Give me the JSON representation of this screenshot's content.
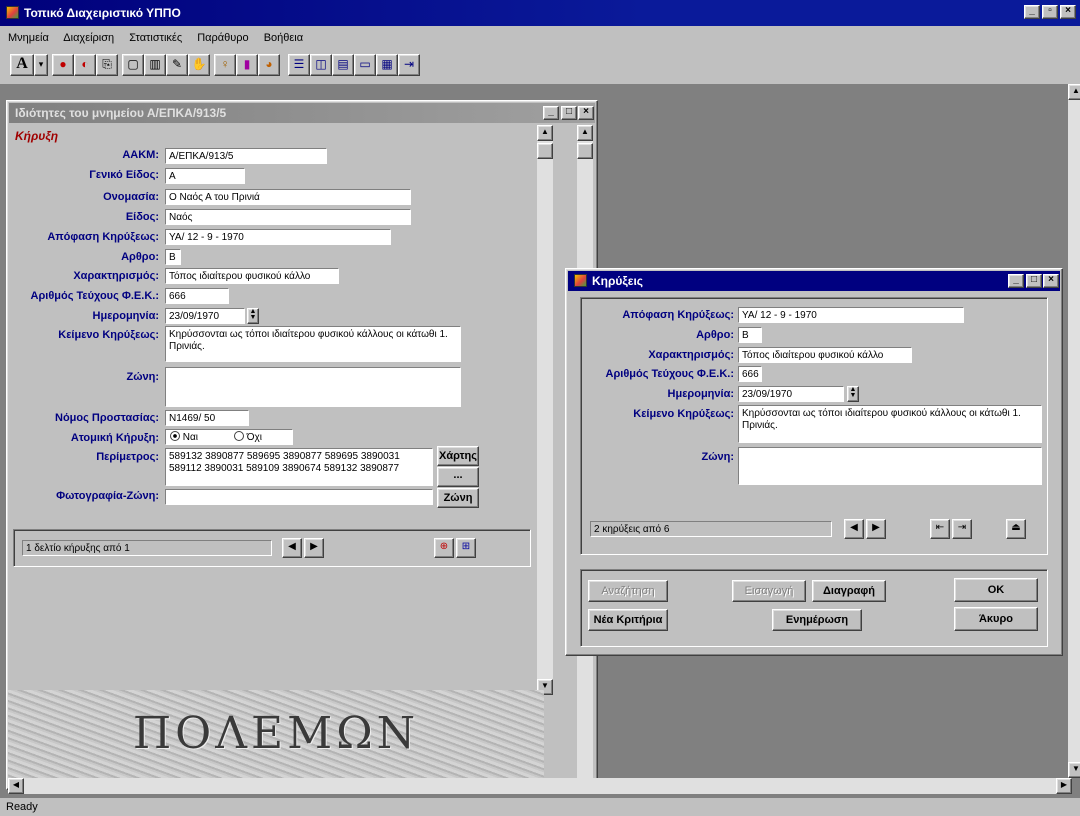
{
  "app": {
    "title": "Τοπικό Διαχειριστικό ΥΠΠΟ"
  },
  "menu": [
    "Μνημεία",
    "Διαχείριση",
    "Στατιστικές",
    "Παράθυρο",
    "Βοήθεια"
  ],
  "toolbar": {
    "font_button": "A",
    "dropdown_arrow": "▾"
  },
  "props_window": {
    "title": "Ιδιότητες του μνημείου Α/ΕΠΚΑ/913/5",
    "section": "Κήρυξη",
    "labels": {
      "aakm": "ΑΑΚΜ:",
      "geniko_eidos": "Γενικό Είδος:",
      "onomasia": "Ονομασία:",
      "eidos": "Είδος:",
      "apofasi": "Απόφαση Κηρύξεως:",
      "arthro": "Αρθρο:",
      "xaraktirismos": "Χαρακτηρισμός:",
      "arithmos_fek": "Αριθμός Τεύχους Φ.Ε.Κ.:",
      "imerominia": "Ημερομηνία:",
      "keimeno": "Κείμενο Κηρύξεως:",
      "zoni": "Ζώνη:",
      "nomos": "Νόμος Προστασίας:",
      "atomiki": "Ατομική Κήρυξη:",
      "perimetros": "Περίμετρος:",
      "fotografia": "Φωτογραφία-Ζώνη:"
    },
    "values": {
      "aakm": "Α/ΕΠΚΑ/913/5",
      "geniko_eidos": "Α",
      "onomasia": "Ο Ναός Α του Πρινιά",
      "eidos": "Ναός",
      "apofasi": "ΥΑ/ 12 - 9 - 1970",
      "arthro": "Β",
      "xaraktirismos": "Τόπος ιδιαίτερου φυσικού κάλλο",
      "arithmos_fek": "666",
      "imerominia": "23/09/1970",
      "keimeno": "Κηρύσσονται ως τόποι ιδιαίτερου φυσικού κάλλους οι κάτωθι 1. Πρινιάς.",
      "zoni": "",
      "nomos": "Ν1469/ 50",
      "radio_yes": "Ναι",
      "radio_no": "Όχι",
      "perimetros": "589132 3890877 589695 3890877 589695 3890031 589112 3890031 589109 3890674 589132 3890877",
      "fotografia": ""
    },
    "buttons": {
      "xartis": "Χάρτης",
      "dots": "...",
      "zoni": "Ζώνη"
    },
    "record_status": "1 δελτίο κήρυξης από 1",
    "banner": "ΠΟΛΕΜΩΝ"
  },
  "dialog": {
    "title": "Κηρύξεις",
    "labels": {
      "apofasi": "Απόφαση Κηρύξεως:",
      "arthro": "Αρθρο:",
      "xaraktirismos": "Χαρακτηρισμός:",
      "arithmos_fek": "Αριθμός Τεύχους Φ.Ε.Κ.:",
      "imerominia": "Ημερομηνία:",
      "keimeno": "Κείμενο Κηρύξεως:",
      "zoni": "Ζώνη:"
    },
    "values": {
      "apofasi": "ΥΑ/ 12 - 9 - 1970",
      "arthro": "Β",
      "xaraktirismos": "Τόπος ιδιαίτερου φυσικού κάλλο",
      "arithmos_fek": "666",
      "imerominia": "23/09/1970",
      "keimeno": "Κηρύσσονται ως τόποι ιδιαίτερου φυσικού κάλλους οι κάτωθι 1. Πρινιάς.",
      "zoni": ""
    },
    "record_status": "2 κηρύξεις από 6",
    "buttons": {
      "anazitisi": "Αναζήτηση",
      "eisagogi": "Εισαγωγή",
      "diagrafi": "Διαγραφή",
      "ok": "OK",
      "nea_kritiria": "Νέα Κριτήρια",
      "enimerosi": "Ενημέρωση",
      "akyro": "Άκυρο"
    }
  },
  "status": "Ready"
}
